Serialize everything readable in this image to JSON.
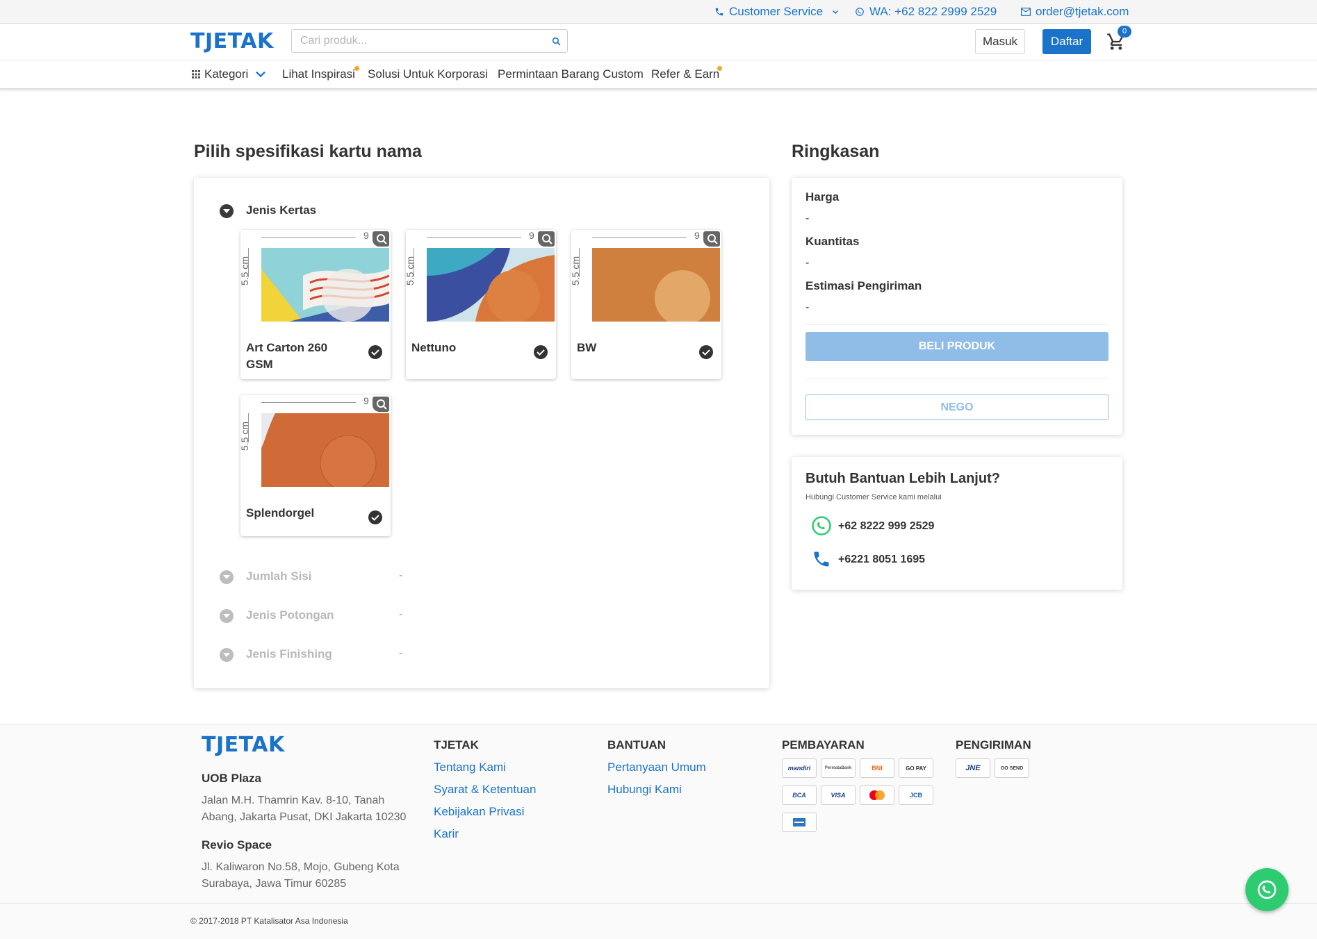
{
  "topbar": {
    "customer_service": "Customer Service",
    "whatsapp": "WA: +62 822 2999 2529",
    "email": "order@tjetak.com"
  },
  "header": {
    "logo": "TJETAK",
    "search_placeholder": "Cari produk...",
    "login_label": "Masuk",
    "register_label": "Daftar",
    "cart_count": "0"
  },
  "nav": {
    "category_label": "Kategori",
    "items": [
      "Lihat Inspirasi",
      "Solusi Untuk Korporasi",
      "Permintaan Barang Custom",
      "Refer & Earn"
    ]
  },
  "spec": {
    "title": "Pilih spesifikasi kartu nama",
    "paper_section": "Jenis Kertas",
    "dim_width": "9",
    "dim_height": "5.5 cm",
    "papers": [
      "Art Carton 260 GSM",
      "Nettuno",
      "BW",
      "Splendorgel"
    ],
    "rows": [
      {
        "label": "Jumlah Sisi",
        "value": "-"
      },
      {
        "label": "Jenis Potongan",
        "value": "-"
      },
      {
        "label": "Jenis Finishing",
        "value": "-"
      }
    ]
  },
  "summary": {
    "title": "Ringkasan",
    "price_label": "Harga",
    "price_value": "-",
    "qty_label": "Kuantitas",
    "qty_value": "-",
    "shipping_label": "Estimasi Pengiriman",
    "shipping_value": "-",
    "buy_label": "BELI PRODUK",
    "nego_label": "NEGO"
  },
  "help": {
    "title": "Butuh Bantuan Lebih Lanjut?",
    "subtitle": "Hubungi Customer Service kami melalui",
    "whatsapp": "+62 8222 999 2529",
    "phone": "+6221 8051 1695"
  },
  "footer": {
    "logo": "TJETAK",
    "office1_title": "UOB Plaza",
    "office1_addr": "Jalan M.H. Thamrin Kav. 8-10, Tanah Abang, Jakarta Pusat, DKI Jakarta 10230",
    "office2_title": "Revio Space",
    "office2_addr": "Jl. Kaliwaron No.58, Mojo, Gubeng Kota Surabaya, Jawa Timur 60285",
    "col_tjetak": "TJETAK",
    "tjetak_links": [
      "Tentang Kami",
      "Syarat & Ketentuan",
      "Kebijakan Privasi",
      "Karir"
    ],
    "col_bantuan": "BANTUAN",
    "bantuan_links": [
      "Pertanyaan Umum",
      "Hubungi Kami"
    ],
    "col_pembayaran": "PEMBAYARAN",
    "payments": [
      "mandiri",
      "PermataBank",
      "BNI",
      "GO PAY",
      "BCA",
      "VISA",
      "mastercard",
      "JCB",
      "AMEX"
    ],
    "col_pengiriman": "PENGIRIMAN",
    "shipping": [
      "JNE",
      "GO SEND"
    ],
    "copyright": "© 2017-2018 PT Katalisator Asa Indonesia"
  },
  "colors": {
    "brand": "#1a73c9",
    "disabled_button": "#90bde8",
    "whatsapp": "#2ecc71",
    "dot": "#f5a623"
  }
}
